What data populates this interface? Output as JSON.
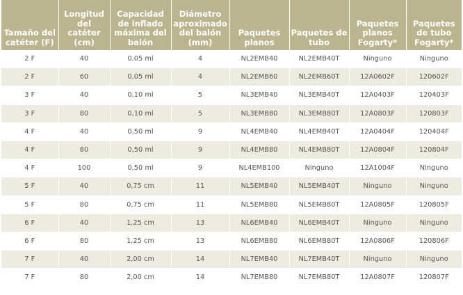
{
  "table": {
    "headers": [
      "Tamaño del catéter (F)",
      "Longitud del catéter (cm)",
      "Capacidad de inflado máxima del balón",
      "Diámetro aproximado del balón (mm)",
      "Paquetes planos",
      "Paquetes de tubo",
      "Paquetes planos Fogarty*",
      "Paquetes de tubo Fogarty*"
    ],
    "rows": [
      [
        "2 F",
        "40",
        "0,05 ml",
        "4",
        "NL2EMB40",
        "NL2EMB40T",
        "Ninguno",
        "Ninguno"
      ],
      [
        "2 F",
        "60",
        "0,05 ml",
        "4",
        "NL2EMB60",
        "NL2EMB60T",
        "12A0602F",
        "120602F"
      ],
      [
        "3 F",
        "40",
        "0,10 ml",
        "5",
        "NL3EMB40",
        "NL3EMB40T",
        "12A0403F",
        "120403F"
      ],
      [
        "3 F",
        "80",
        "0,10 ml",
        "5",
        "NL3EMB80",
        "NL3EMB80T",
        "12A0803F",
        "120803F"
      ],
      [
        "4 F",
        "40",
        "0,50 ml",
        "9",
        "NL4EMB40",
        "NL4EMB40T",
        "12A0404F",
        "120404F"
      ],
      [
        "4 F",
        "80",
        "0,50 ml",
        "9",
        "NL4EMB80",
        "NL4EMB80T",
        "12A0804F",
        "120804F"
      ],
      [
        "4 F",
        "100",
        "0,50 ml",
        "9",
        "NL4EMB100",
        "Ninguno",
        "12A1004F",
        "Ninguno"
      ],
      [
        "5 F",
        "40",
        "0,75 cm",
        "11",
        "NL5EMB40",
        "NL5EMB40T",
        "Ninguno",
        "Ninguno"
      ],
      [
        "5 F",
        "80",
        "0,75 cm",
        "11",
        "NL5EMB80",
        "NL5EMB80T",
        "12A0805F",
        "120805F"
      ],
      [
        "6 F",
        "40",
        "1,25 cm",
        "13",
        "NL6EMB40",
        "NL6EMB40T",
        "Ninguno",
        "Ninguno"
      ],
      [
        "6 F",
        "80",
        "1,25 cm",
        "13",
        "NL6EMB80",
        "NL6EMB80T",
        "12A0806F",
        "120806F"
      ],
      [
        "7 F",
        "40",
        "2,00 cm",
        "14",
        "NL7EMB40",
        "NL7EMB40T",
        "Ninguno",
        "Ninguno"
      ],
      [
        "7 F",
        "80",
        "2,00 cm",
        "14",
        "NL7EMB80",
        "NL7EMB80T",
        "12A0807F",
        "120807F"
      ]
    ]
  },
  "colors": {
    "header_bg": "#bbb58f",
    "header_text": "#ffffff",
    "row_alt_bg": "#eeebe1",
    "cell_text": "#555555"
  }
}
